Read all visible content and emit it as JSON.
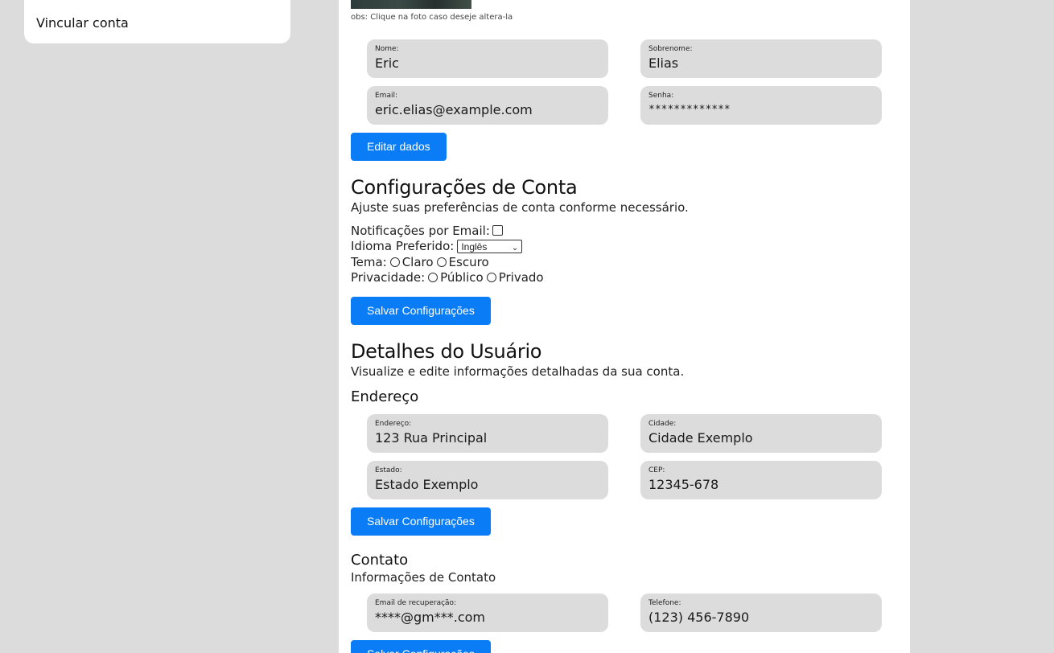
{
  "sidebar": {
    "link_label": "Vincular conta"
  },
  "profile": {
    "photo_note": "obs: Clique na foto caso deseje altera-la",
    "fields": {
      "nome": {
        "label": "Nome:",
        "value": "Eric"
      },
      "sobrenome": {
        "label": "Sobrenome:",
        "value": "Elias"
      },
      "email": {
        "label": "Email:",
        "value": "eric.elias@example.com"
      },
      "senha": {
        "label": "Senha:",
        "value": "*************"
      }
    },
    "edit_button": "Editar dados"
  },
  "account_settings": {
    "title": "Configurações de Conta",
    "subtitle": "Ajuste suas preferências de conta conforme necessário.",
    "email_notifications_label": "Notificações por Email:",
    "language_label": "Idioma Preferido:",
    "language_value": "Inglês",
    "theme_label": "Tema:",
    "theme_options": [
      "Claro",
      "Escuro"
    ],
    "privacy_label": "Privacidade:",
    "privacy_options": [
      "Público",
      "Privado"
    ],
    "save_button": "Salvar Configurações"
  },
  "user_details": {
    "title": "Detalhes do Usuário",
    "subtitle": "Visualize e edite informações detalhadas da sua conta.",
    "address": {
      "title": "Endereço",
      "fields": {
        "endereco": {
          "label": "Endereço:",
          "value": "123 Rua Principal"
        },
        "cidade": {
          "label": "Cidade:",
          "value": "Cidade Exemplo"
        },
        "estado": {
          "label": "Estado:",
          "value": "Estado Exemplo"
        },
        "cep": {
          "label": "CEP:",
          "value": "12345-678"
        }
      },
      "save_button": "Salvar Configurações"
    },
    "contact": {
      "title": "Contato",
      "subtitle": "Informações de Contato",
      "fields": {
        "recovery_email": {
          "label": "Email de recuperação:",
          "value": "****@gm***.com"
        },
        "telefone": {
          "label": "Telefone:",
          "value": "(123) 456-7890"
        }
      },
      "save_button": "Salvar Configurações"
    }
  }
}
